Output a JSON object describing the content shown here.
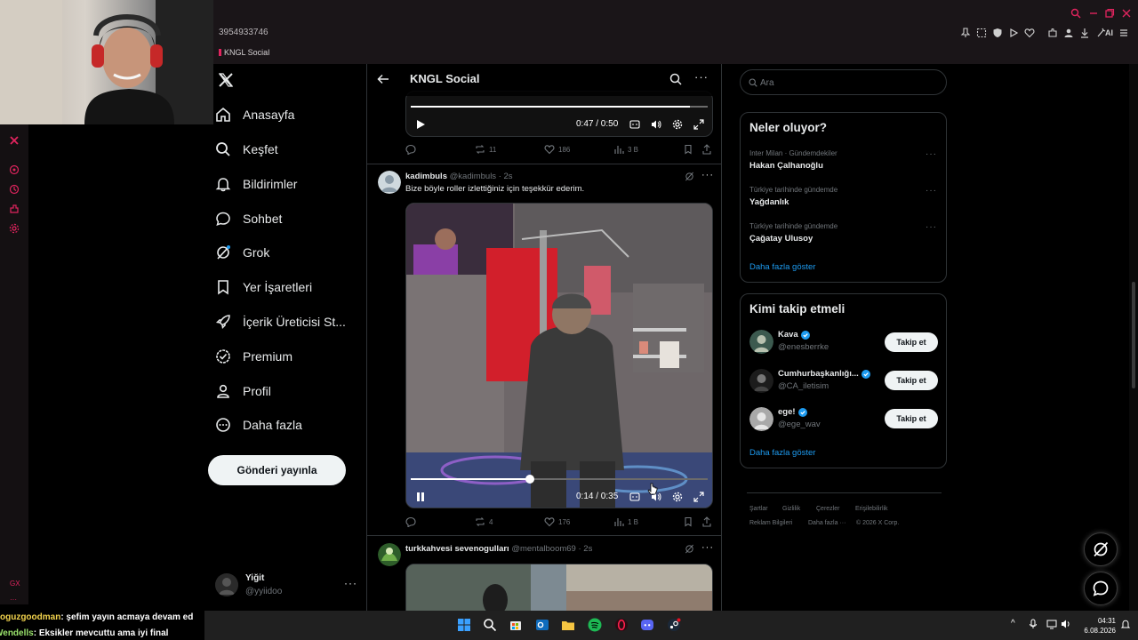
{
  "browser": {
    "url_fragment": "3954933746",
    "tab_title": "KNGL Social",
    "ai_label": "AI"
  },
  "nav": {
    "items": [
      {
        "label": "Anasayfa",
        "icon": "home-icon"
      },
      {
        "label": "Keşfet",
        "icon": "search-icon"
      },
      {
        "label": "Bildirimler",
        "icon": "bell-icon"
      },
      {
        "label": "Sohbet",
        "icon": "chat-icon"
      },
      {
        "label": "Grok",
        "icon": "grok-icon"
      },
      {
        "label": "Yer İşaretleri",
        "icon": "bookmark-icon"
      },
      {
        "label": "İçerik Üreticisi St...",
        "icon": "rocket-icon"
      },
      {
        "label": "Premium",
        "icon": "verified-icon"
      },
      {
        "label": "Profil",
        "icon": "person-icon"
      },
      {
        "label": "Daha fazla",
        "icon": "more-circle-icon"
      }
    ],
    "post_button": "Gönderi yayınla",
    "account": {
      "name": "Yiğit",
      "handle": "@yyiidoo"
    }
  },
  "column": {
    "title": "KNGL Social"
  },
  "tweets": [
    {
      "video_time": "0:47 / 0:50",
      "video_progress": 0.94,
      "replies": "",
      "retweets": "11",
      "likes": "186",
      "views": "3 B"
    },
    {
      "name": "kadimbuls",
      "handle": "@kadimbuls",
      "age": "· 2s",
      "text": "Bize böyle roller izlettiğiniz için teşekkür ederim.",
      "video_time": "0:14 / 0:35",
      "video_progress": 0.4,
      "retweets": "4",
      "likes": "176",
      "views": "1 B"
    },
    {
      "name": "turkkahvesi sevenogulları",
      "handle": "@mentalboom69",
      "age": "· 2s"
    }
  ],
  "sidebar": {
    "search_placeholder": "Ara",
    "trends_title": "Neler oluyor?",
    "trends": [
      {
        "meta": "Inter Milan · Gündemdekiler",
        "name": "Hakan Çalhanoğlu"
      },
      {
        "meta": "Türkiye tarihinde gündemde",
        "name": "Yağdanlık"
      },
      {
        "meta": "Türkiye tarihinde gündemde",
        "name": "Çağatay Ulusoy"
      }
    ],
    "trends_show_more": "Daha fazla göster",
    "who_title": "Kimi takip etmeli",
    "who": [
      {
        "name": "Kava",
        "handle": "@enesberrke"
      },
      {
        "name": "Cumhurbaşkanlığı...",
        "handle": "@CA_iletisim"
      },
      {
        "name": "ege!",
        "handle": "@ege_wav"
      }
    ],
    "follow_label": "Takip et",
    "who_show_more": "Daha fazla göster",
    "footer": {
      "line1": [
        "Şartlar",
        "Gizlilik",
        "Çerezler",
        "Erişilebilirlik"
      ],
      "line2": [
        "Reklam Bilgileri",
        "Daha fazla ···",
        "© 2026 X Corp."
      ]
    }
  },
  "chat": [
    {
      "user": "oguzgoodman",
      "message": ": şefim yayın acmaya devam ed"
    },
    {
      "user": "Wendells",
      "message": ": Eksikler mevcuttu ama iyi final"
    }
  ],
  "taskbar": {
    "time": "04:31",
    "date": "6.08.2026"
  },
  "left_rail": {
    "gx_label": "GX",
    "more_label": "···"
  },
  "colors": {
    "accent_blue": "#1d9bf0",
    "opera_red": "#e0245e",
    "background": "#000000",
    "border": "#2f3336"
  }
}
